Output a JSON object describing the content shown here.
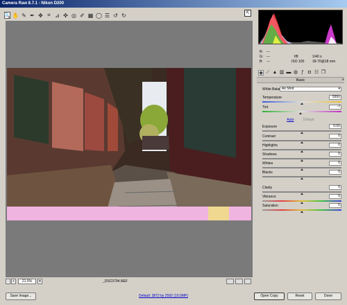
{
  "window": {
    "title": "Camera Raw 8.7.1  -  Nikon D200"
  },
  "toolbar": {
    "tools": [
      {
        "name": "zoom-tool",
        "glyph": "🔍"
      },
      {
        "name": "hand-tool",
        "glyph": "✋"
      },
      {
        "name": "white-balance-tool",
        "glyph": "✎"
      },
      {
        "name": "color-sampler-tool",
        "glyph": "✒"
      },
      {
        "name": "targeted-adjustment-tool",
        "glyph": "✥"
      },
      {
        "name": "crop-tool",
        "glyph": "⌗"
      },
      {
        "name": "straighten-tool",
        "glyph": "⊿"
      },
      {
        "name": "spot-removal-tool",
        "glyph": "✜"
      },
      {
        "name": "red-eye-tool",
        "glyph": "◎"
      },
      {
        "name": "adjustment-brush-tool",
        "glyph": "✐"
      },
      {
        "name": "graduated-filter-tool",
        "glyph": "▦"
      },
      {
        "name": "radial-filter-tool",
        "glyph": "◯"
      },
      {
        "name": "preferences-tool",
        "glyph": "☰"
      },
      {
        "name": "rotate-ccw-tool",
        "glyph": "↺"
      },
      {
        "name": "rotate-cw-tool",
        "glyph": "↻"
      }
    ]
  },
  "status": {
    "zoom_value": "21.5%",
    "zoom_minus": "-",
    "zoom_plus": "+",
    "filename": "_DSC0794.NEF"
  },
  "readout": {
    "r_label": "R:",
    "g_label": "G:",
    "b_label": "B:",
    "r_value": "---",
    "g_value": "---",
    "b_value": "---",
    "aperture": "f/8",
    "shutter": "1/40 s",
    "iso": "ISO 100",
    "lens": "18-70@18 mm"
  },
  "panel": {
    "section_title": "Basic",
    "white_balance_label": "White Balance:",
    "white_balance_value": "As Shot",
    "auto_label": "Auto",
    "default_label": "Default",
    "sliders": {
      "temperature": {
        "label": "Temperature",
        "value": "5550",
        "position": 0.5
      },
      "tint": {
        "label": "Tint",
        "value": "-7",
        "position": 0.48
      },
      "exposure": {
        "label": "Exposure",
        "value": "0.00",
        "position": 0.5
      },
      "contrast": {
        "label": "Contrast",
        "value": "0",
        "position": 0.5
      },
      "highlights": {
        "label": "Highlights",
        "value": "0",
        "position": 0.5
      },
      "shadows": {
        "label": "Shadows",
        "value": "0",
        "position": 0.5
      },
      "whites": {
        "label": "Whites",
        "value": "0",
        "position": 0.5
      },
      "blacks": {
        "label": "Blacks",
        "value": "0",
        "position": 0.5
      },
      "clarity": {
        "label": "Clarity",
        "value": "0",
        "position": 0.5
      },
      "vibrance": {
        "label": "Vibrance",
        "value": "0",
        "position": 0.5
      },
      "saturation": {
        "label": "Saturation",
        "value": "0",
        "position": 0.5
      }
    }
  },
  "footer": {
    "save_image_label": "Save Image...",
    "workflow_link": "Default: 3872 by 2592 (10.0MP)",
    "open_copy_label": "Open Copy",
    "reset_label": "Reset",
    "done_label": "Done"
  },
  "colors": {
    "accent_link": "#0000cc",
    "titlebar_start": "#0a246a",
    "titlebar_end": "#a6caf0"
  }
}
